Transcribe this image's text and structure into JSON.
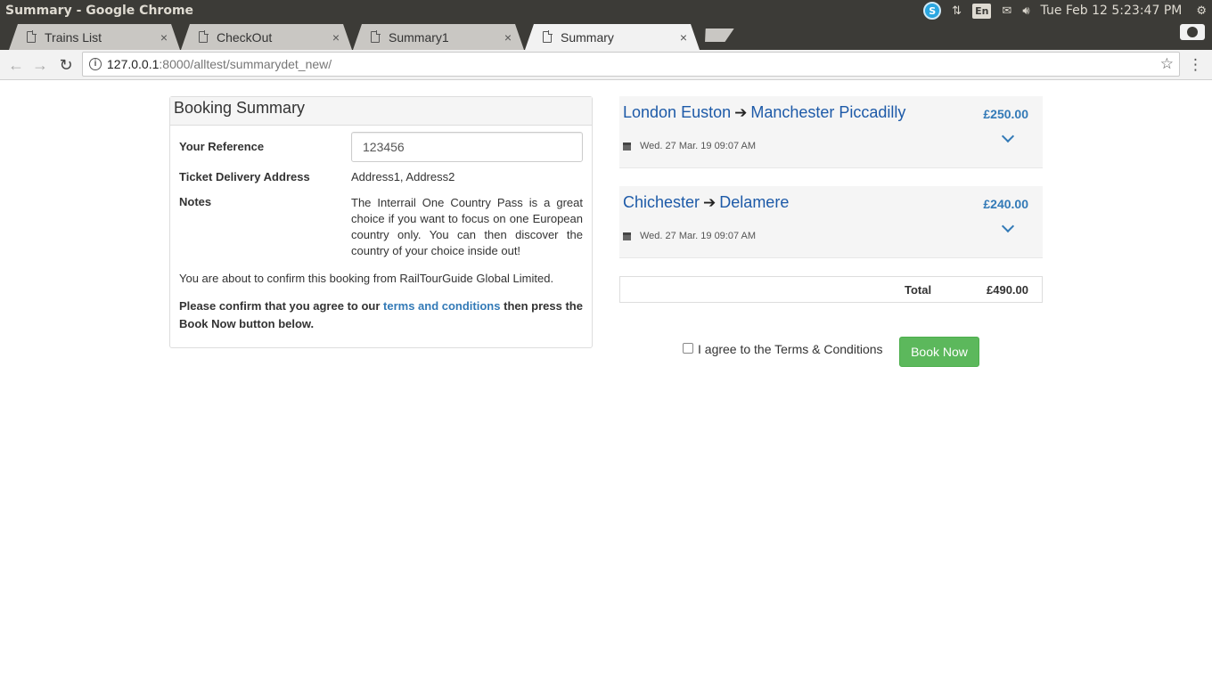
{
  "os": {
    "window_title": "Summary - Google Chrome",
    "lang": "En",
    "clock": "Tue Feb 12  5:23:47 PM"
  },
  "tabs": [
    {
      "label": "Trains List",
      "close": "×"
    },
    {
      "label": "CheckOut",
      "close": "×"
    },
    {
      "label": "Summary1",
      "close": "×"
    },
    {
      "label": "Summary",
      "close": "×"
    }
  ],
  "address_bar": {
    "host": "127.0.0.1",
    "path": ":8000/alltest/summarydet_new/"
  },
  "booking_summary": {
    "title": "Booking Summary",
    "reference_label": "Your Reference",
    "reference_value": "123456",
    "delivery_label": "Ticket Delivery Address",
    "delivery_value": "Address1, Address2",
    "notes_label": "Notes",
    "notes_value": "The Interrail One Country Pass is a great choice if you want to focus on one European country only. You can then discover the country of your choice inside out!",
    "confirm_text": "You are about to confirm this booking from RailTourGuide Global Limited.",
    "agree_prefix": "Please confirm that you agree to our",
    "agree_link": "terms and conditions",
    "agree_suffix": "then press the Book Now button below."
  },
  "journeys": [
    {
      "from": "London Euston",
      "to": "Manchester Piccadilly",
      "date": "Wed. 27 Mar. 19 09:07 AM",
      "price": "£250.00"
    },
    {
      "from": "Chichester",
      "to": "Delamere",
      "date": "Wed. 27 Mar. 19 09:07 AM",
      "price": "£240.00"
    }
  ],
  "total": {
    "label": "Total",
    "value": "£490.00"
  },
  "agree_checkbox_label": "I agree to the Terms & Conditions",
  "book_button": "Book Now"
}
